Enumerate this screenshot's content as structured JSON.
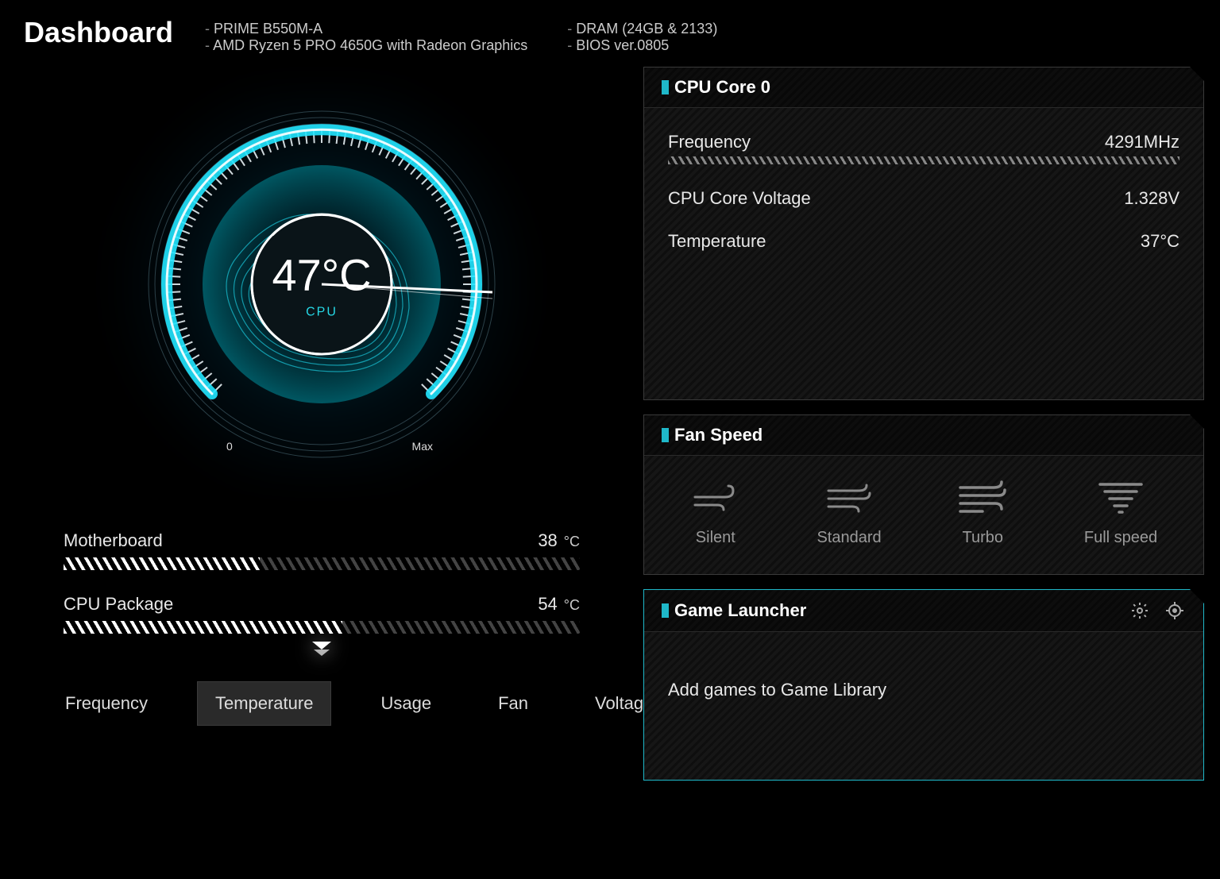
{
  "header": {
    "title": "Dashboard",
    "info_col1": [
      "PRIME B550M-A",
      "AMD Ryzen 5 PRO 4650G with Radeon Graphics"
    ],
    "info_col2": [
      "DRAM (24GB & 2133)",
      "BIOS ver.0805"
    ]
  },
  "gauge": {
    "value": "47°C",
    "label": "CPU",
    "zero": "0",
    "max": "Max"
  },
  "temps": [
    {
      "label": "Motherboard",
      "value": "38",
      "unit": "°C",
      "pct": 38
    },
    {
      "label": "CPU Package",
      "value": "54",
      "unit": "°C",
      "pct": 54
    }
  ],
  "tabs": [
    "Frequency",
    "Temperature",
    "Usage",
    "Fan",
    "Voltage"
  ],
  "active_tab": "Temperature",
  "cpu_panel": {
    "title": "CPU Core 0",
    "rows": [
      {
        "label": "Frequency",
        "value": "4291MHz",
        "bar": true
      },
      {
        "label": "CPU Core Voltage",
        "value": "1.328V",
        "bar": false
      },
      {
        "label": "Temperature",
        "value": "37°C",
        "bar": false
      }
    ]
  },
  "fan_panel": {
    "title": "Fan Speed",
    "modes": [
      "Silent",
      "Standard",
      "Turbo",
      "Full speed"
    ]
  },
  "game_panel": {
    "title": "Game Launcher",
    "body": "Add games to Game Library"
  }
}
